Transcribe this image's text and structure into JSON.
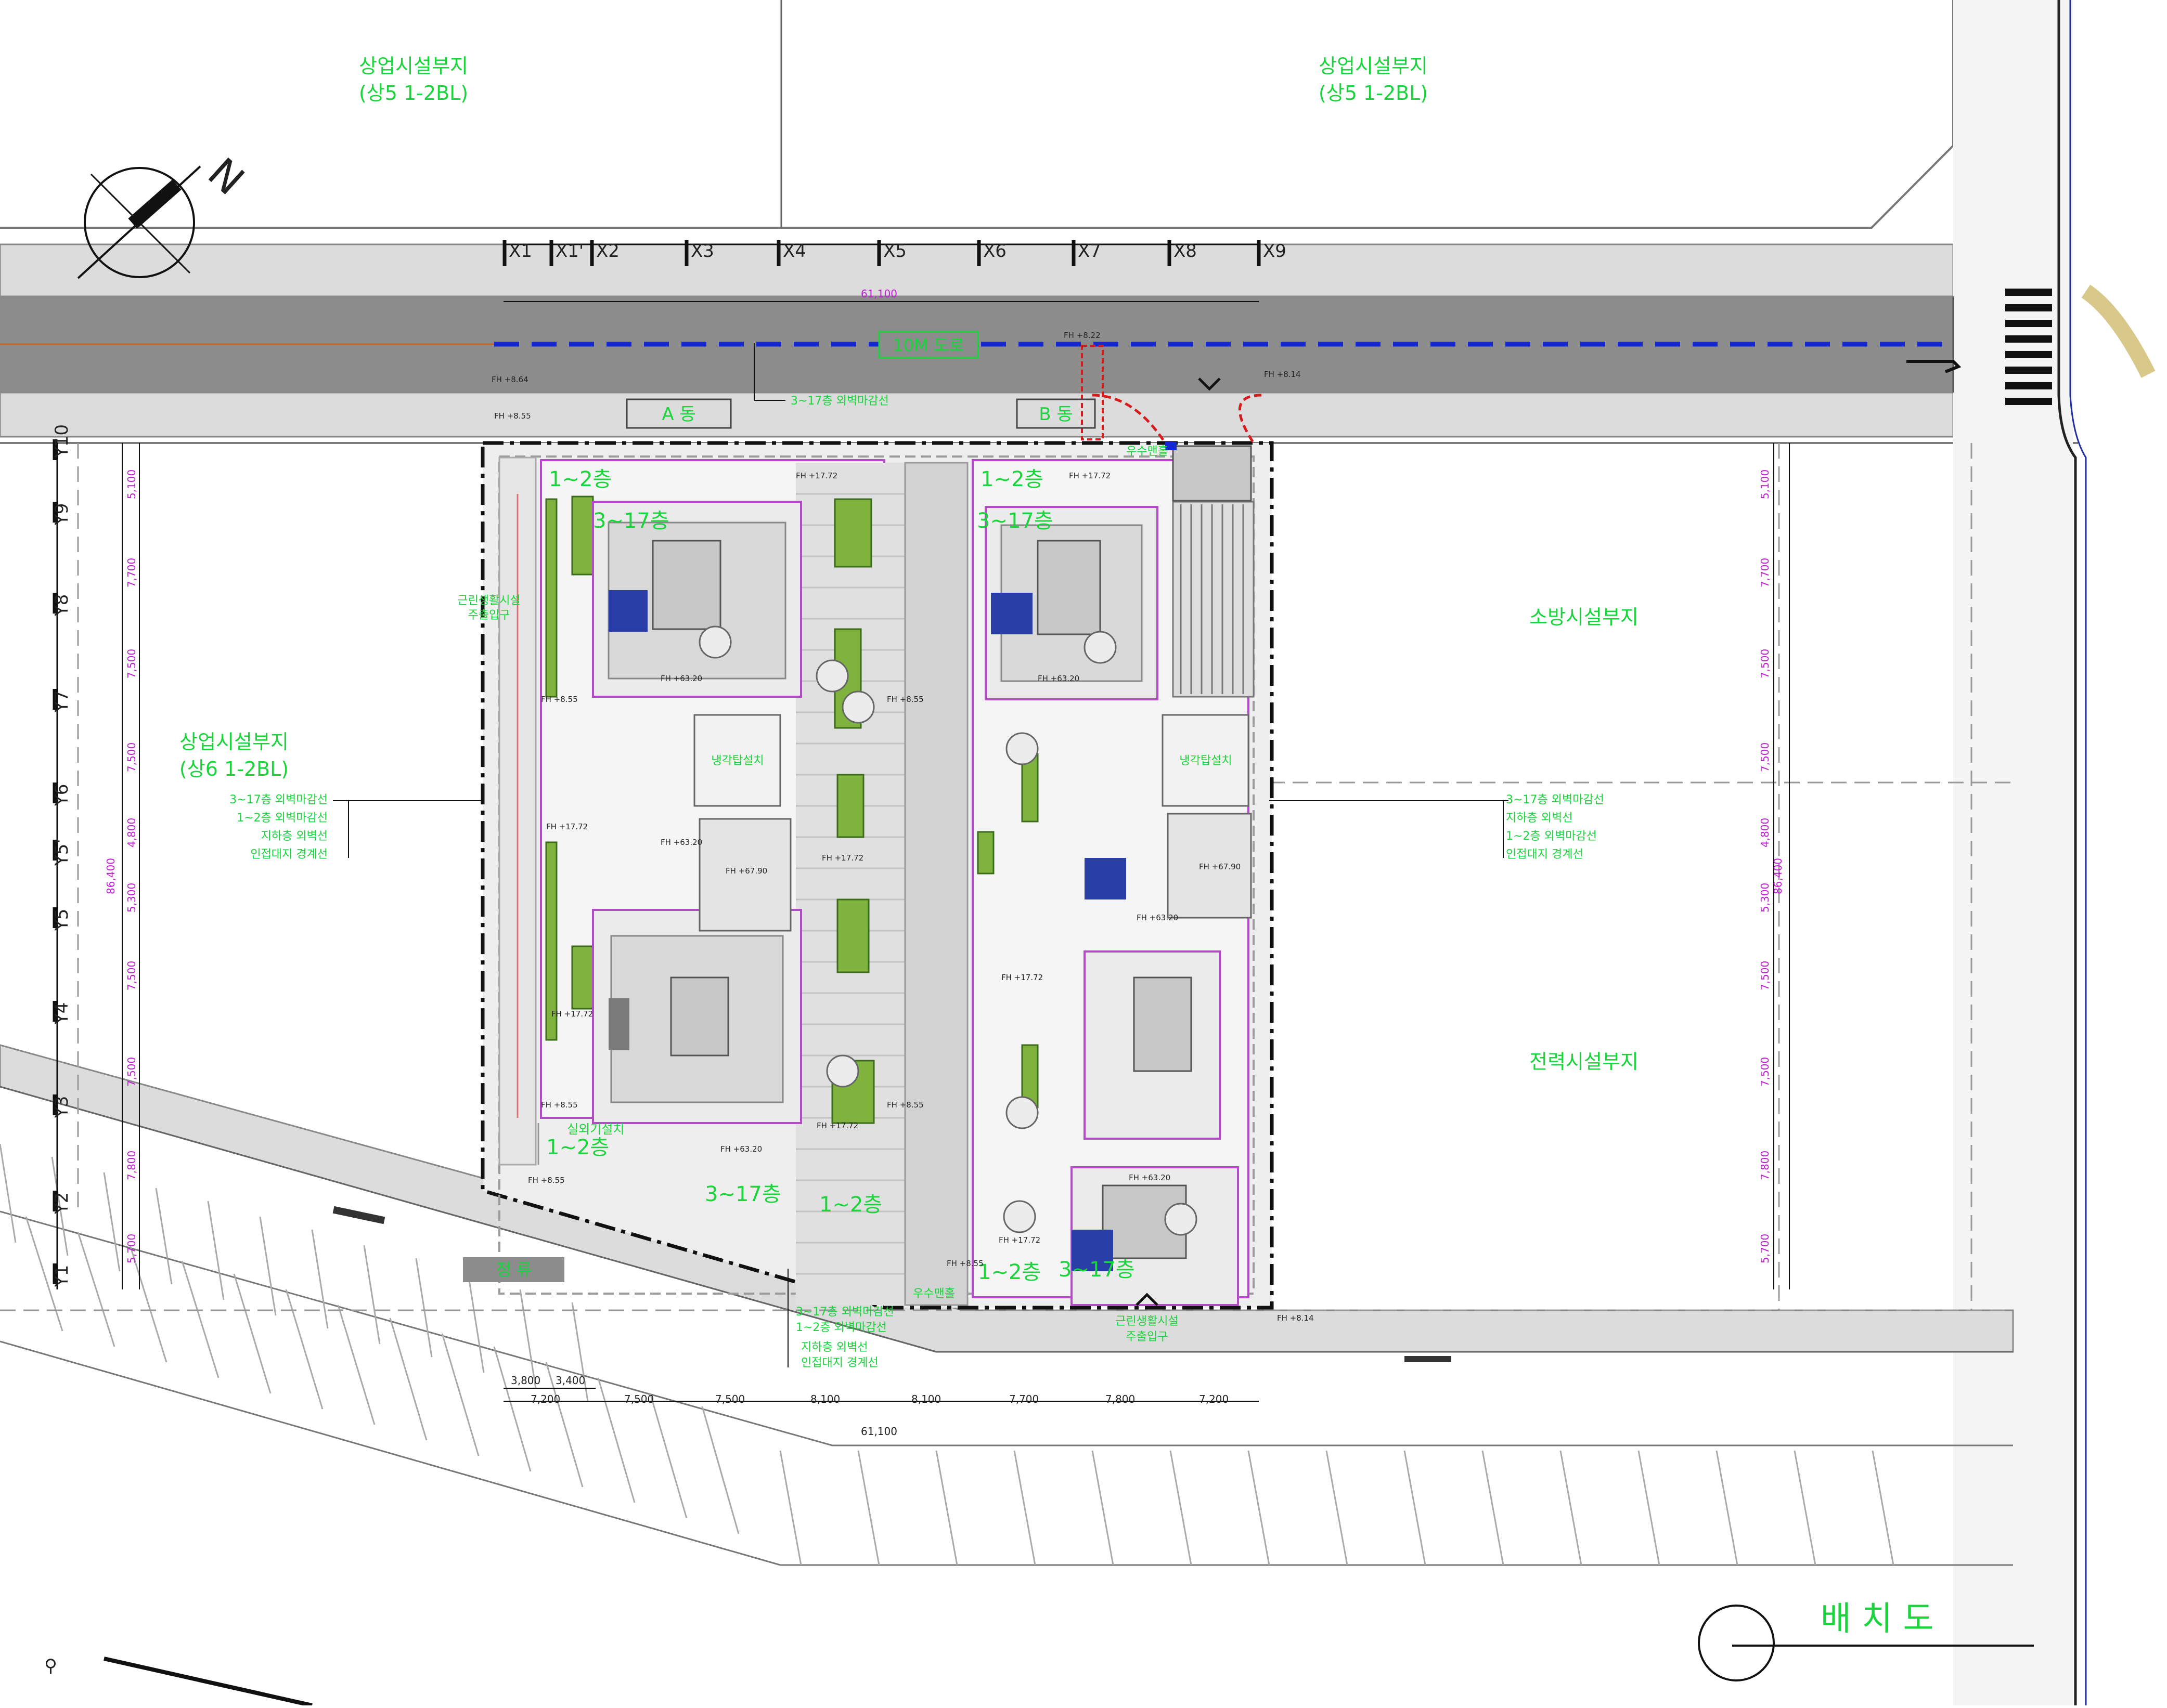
{
  "colors": {
    "label_green": "#19d43a",
    "dim_magenta": "#c21ad6",
    "road_gray": "#8c8c8c",
    "centerline_blue": "#1428d2",
    "boundary_red": "#d61c1c",
    "line_black": "#1a1a1a",
    "paving_gray": "#dadada"
  },
  "sites": {
    "commercial_top_left": "상업시설부지",
    "commercial_top_left_code": "(상5 1-2BL)",
    "commercial_top_right": "상업시설부지",
    "commercial_top_right_code": "(상5 1-2BL)",
    "commercial_left": "상업시설부지",
    "commercial_left_code": "(상6 1-2BL)",
    "fire_station": "소방시설부지",
    "power_facility": "전력시설부지"
  },
  "road": {
    "name": "10M 도로"
  },
  "drawing_title": "배 치 도",
  "north_mark": "N",
  "grid_x": [
    "X1",
    "X1'",
    "X2",
    "X3",
    "X4",
    "X5",
    "X6",
    "X7",
    "X8",
    "X9"
  ],
  "grid_y": [
    "Y10",
    "Y9",
    "Y8",
    "Y7",
    "Y6",
    "Y5'",
    "Y5",
    "Y4",
    "Y3",
    "Y2",
    "Y1"
  ],
  "dims": {
    "top_total": "61,100",
    "bottom_total": "61,100",
    "bottom_sub": [
      "3,800",
      "3,400"
    ],
    "bottom": [
      "7,200",
      "7,500",
      "7,500",
      "8,100",
      "8,100",
      "7,700",
      "7,800",
      "7,200"
    ],
    "left_total": "86,400",
    "right_total": "86,400",
    "side": [
      "5,100",
      "7,700",
      "7,500",
      "7,500",
      "4,800",
      "5,300",
      "7,500",
      "7,500",
      "7,800",
      "5,700"
    ]
  },
  "buildings": {
    "a_dong": "A 동",
    "b_dong": "B 동",
    "floors_1_2": "1~2층",
    "floors_3_17": "3~17층",
    "cooling_tower": "냉각탑설치",
    "outdoor_unit": "실외기설치"
  },
  "legend_lines": {
    "l1": "3~17층 외벽마감선",
    "l2": "1~2층 외벽마감선",
    "l3": "지하층 외벽선",
    "l4": "인접대지 경계선"
  },
  "right_legend": {
    "l1": "3~17층 외벽마감선",
    "l2": "지하층 외벽선",
    "l3": "1~2층 외벽마감선",
    "l4": "인접대지 경계선"
  },
  "bottom_legend": {
    "l1": "3~17층 외벽마감선",
    "l2": "1~2층 외벽마감선",
    "l3": "지하층 외벽선",
    "l4": "인접대지 경계선"
  },
  "notes": {
    "facility_entrance": "근린생활시설",
    "facility_entrance_2": "주출입구",
    "bus_stop": "정 류",
    "garbage": "우수맨홀",
    "fh1": "FH +17.72",
    "fh2": "FH +63.20",
    "fh3": "FH +67.90",
    "fh4": "FH +8.55",
    "fh5": "FH +8.14",
    "fh6": "FH +8.22",
    "fh7": "FH +8.64"
  }
}
